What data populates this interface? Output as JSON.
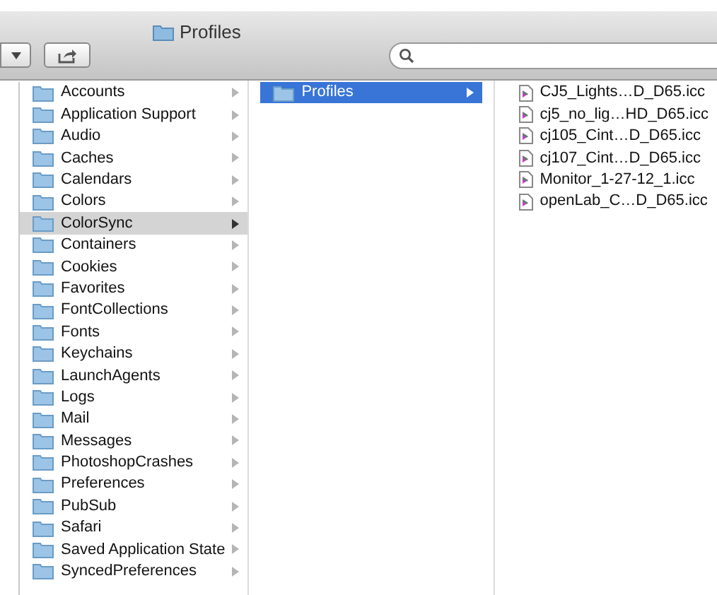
{
  "window": {
    "title": "Profiles"
  },
  "columns": [
    {
      "items": [
        {
          "name": "Accounts",
          "kind": "folder",
          "selected": false
        },
        {
          "name": "Application Support",
          "kind": "folder",
          "selected": false
        },
        {
          "name": "Audio",
          "kind": "folder",
          "selected": false
        },
        {
          "name": "Caches",
          "kind": "folder",
          "selected": false
        },
        {
          "name": "Calendars",
          "kind": "folder",
          "selected": false
        },
        {
          "name": "Colors",
          "kind": "folder",
          "selected": false
        },
        {
          "name": "ColorSync",
          "kind": "folder",
          "selected": true
        },
        {
          "name": "Containers",
          "kind": "folder",
          "selected": false
        },
        {
          "name": "Cookies",
          "kind": "folder",
          "selected": false
        },
        {
          "name": "Favorites",
          "kind": "folder",
          "selected": false
        },
        {
          "name": "FontCollections",
          "kind": "folder",
          "selected": false
        },
        {
          "name": "Fonts",
          "kind": "folder",
          "selected": false
        },
        {
          "name": "Keychains",
          "kind": "folder",
          "selected": false
        },
        {
          "name": "LaunchAgents",
          "kind": "folder",
          "selected": false
        },
        {
          "name": "Logs",
          "kind": "folder",
          "selected": false
        },
        {
          "name": "Mail",
          "kind": "folder",
          "selected": false
        },
        {
          "name": "Messages",
          "kind": "folder",
          "selected": false
        },
        {
          "name": "PhotoshopCrashes",
          "kind": "folder",
          "selected": false
        },
        {
          "name": "Preferences",
          "kind": "folder",
          "selected": false
        },
        {
          "name": "PubSub",
          "kind": "folder",
          "selected": false
        },
        {
          "name": "Safari",
          "kind": "folder",
          "selected": false
        },
        {
          "name": "Saved Application State",
          "kind": "folder",
          "selected": false
        },
        {
          "name": "SyncedPreferences",
          "kind": "folder",
          "selected": false
        }
      ]
    },
    {
      "items": [
        {
          "name": "Profiles",
          "kind": "folder",
          "selected": true
        }
      ]
    },
    {
      "items": [
        {
          "name": "CJ5_Lights…D_D65.icc",
          "kind": "file",
          "selected": false
        },
        {
          "name": "cj5_no_lig…HD_D65.icc",
          "kind": "file",
          "selected": false
        },
        {
          "name": "cj105_Cint…D_D65.icc",
          "kind": "file",
          "selected": false
        },
        {
          "name": "cj107_Cint…D_D65.icc",
          "kind": "file",
          "selected": false
        },
        {
          "name": "Monitor_1-27-12_1.icc",
          "kind": "file",
          "selected": false
        },
        {
          "name": "openLab_C…D_D65.icc",
          "kind": "file",
          "selected": false
        }
      ]
    }
  ]
}
